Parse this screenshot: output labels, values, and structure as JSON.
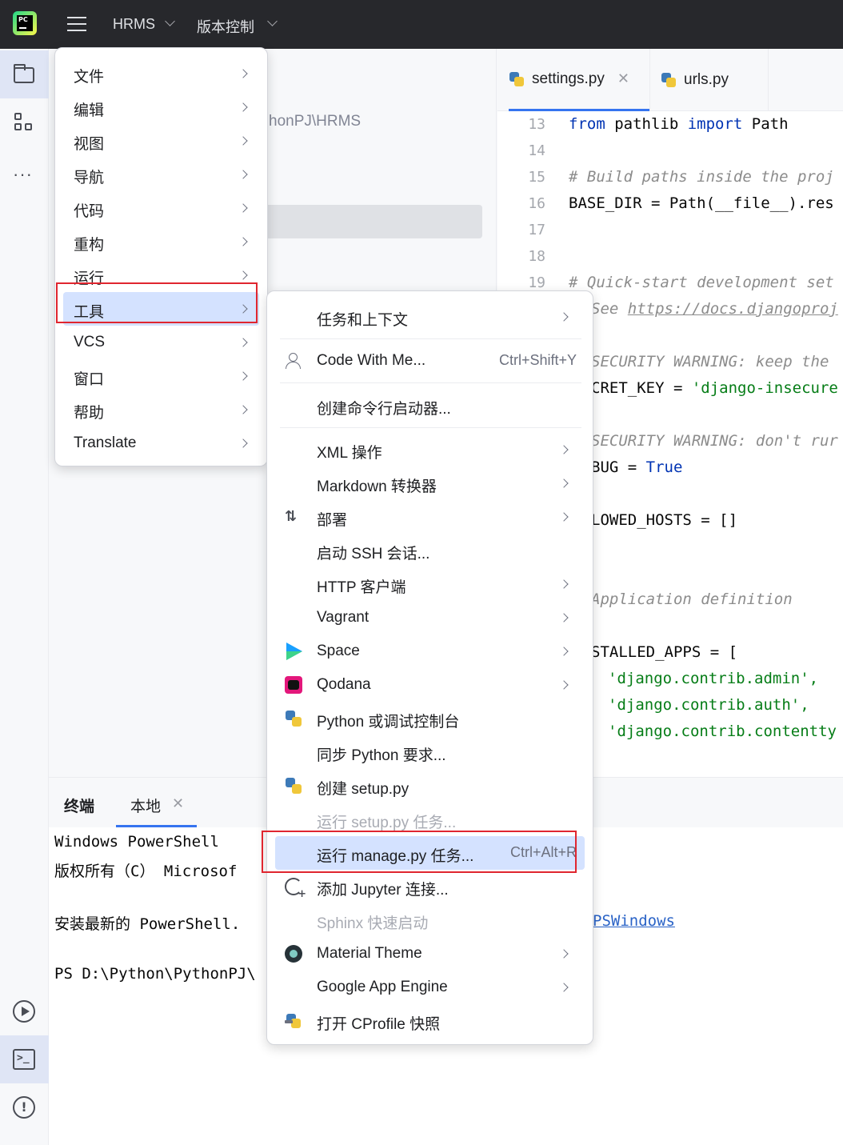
{
  "titlebar": {
    "project": "HRMS",
    "vcs": "版本控制"
  },
  "project_pane": {
    "path_fragment": "honPJ\\HRMS"
  },
  "editor": {
    "tabs": [
      {
        "label": "settings.py",
        "active": true
      },
      {
        "label": "urls.py",
        "active": false
      }
    ],
    "line_numbers": [
      "13",
      "14",
      "15",
      "16",
      "17",
      "18",
      "19"
    ],
    "code": {
      "l13": "from pathlib import Path",
      "l15": "# Build paths inside the proj",
      "l16": "BASE_DIR = Path(__file__).res",
      "l19": "# Quick-start development set",
      "l20_prefix": "See ",
      "l20_link": "https://docs.djangoproj",
      "l22": "SECURITY WARNING: keep the",
      "l23_pre": "CRET_KEY = ",
      "l23_str": "'django-insecure",
      "l25": "SECURITY WARNING: don't rur",
      "l26_pre": "BUG = ",
      "l26_kw": "True",
      "l28": "LOWED_HOSTS = []",
      "l31": "Application definition",
      "l33": "STALLED_APPS = [",
      "l34": "'django.contrib.admin',",
      "l35": "'django.contrib.auth',",
      "l36": "'django.contrib.contentty"
    }
  },
  "terminal": {
    "title": "终端",
    "tab_label": "本地",
    "lines": [
      "Windows PowerShell",
      "版权所有（C） Microsof",
      "",
      "安装最新的 PowerShell.",
      "",
      "PS D:\\Python\\PythonPJ\\"
    ],
    "link": "PSWindows"
  },
  "main_menu": {
    "items": [
      {
        "label": "文件"
      },
      {
        "label": "编辑"
      },
      {
        "label": "视图"
      },
      {
        "label": "导航"
      },
      {
        "label": "代码"
      },
      {
        "label": "重构"
      },
      {
        "label": "运行"
      },
      {
        "label": "工具"
      },
      {
        "label": "VCS"
      },
      {
        "label": "窗口"
      },
      {
        "label": "帮助"
      },
      {
        "label": "Translate"
      }
    ]
  },
  "tools_menu": {
    "items": [
      {
        "label": "任务和上下文"
      },
      {
        "label": "Code With Me...",
        "shortcut": "Ctrl+Shift+Y"
      },
      {
        "label": "创建命令行启动器..."
      },
      {
        "label": "XML 操作"
      },
      {
        "label": "Markdown 转换器"
      },
      {
        "label": "部署"
      },
      {
        "label": "启动 SSH 会话..."
      },
      {
        "label": "HTTP 客户端"
      },
      {
        "label": "Vagrant"
      },
      {
        "label": "Space"
      },
      {
        "label": "Qodana"
      },
      {
        "label": "Python 或调试控制台"
      },
      {
        "label": "同步 Python 要求..."
      },
      {
        "label": "创建 setup.py"
      },
      {
        "label": "运行 setup.py 任务..."
      },
      {
        "label": "运行 manage.py 任务...",
        "shortcut": "Ctrl+Alt+R"
      },
      {
        "label": "添加 Jupyter 连接..."
      },
      {
        "label": "Sphinx 快速启动"
      },
      {
        "label": "Material Theme"
      },
      {
        "label": "Google App Engine"
      },
      {
        "label": "打开 CProfile 快照"
      }
    ]
  },
  "colors": {
    "accent": "#3574f0",
    "highlight_box": "#e0262f",
    "selection": "#d4e2ff"
  }
}
